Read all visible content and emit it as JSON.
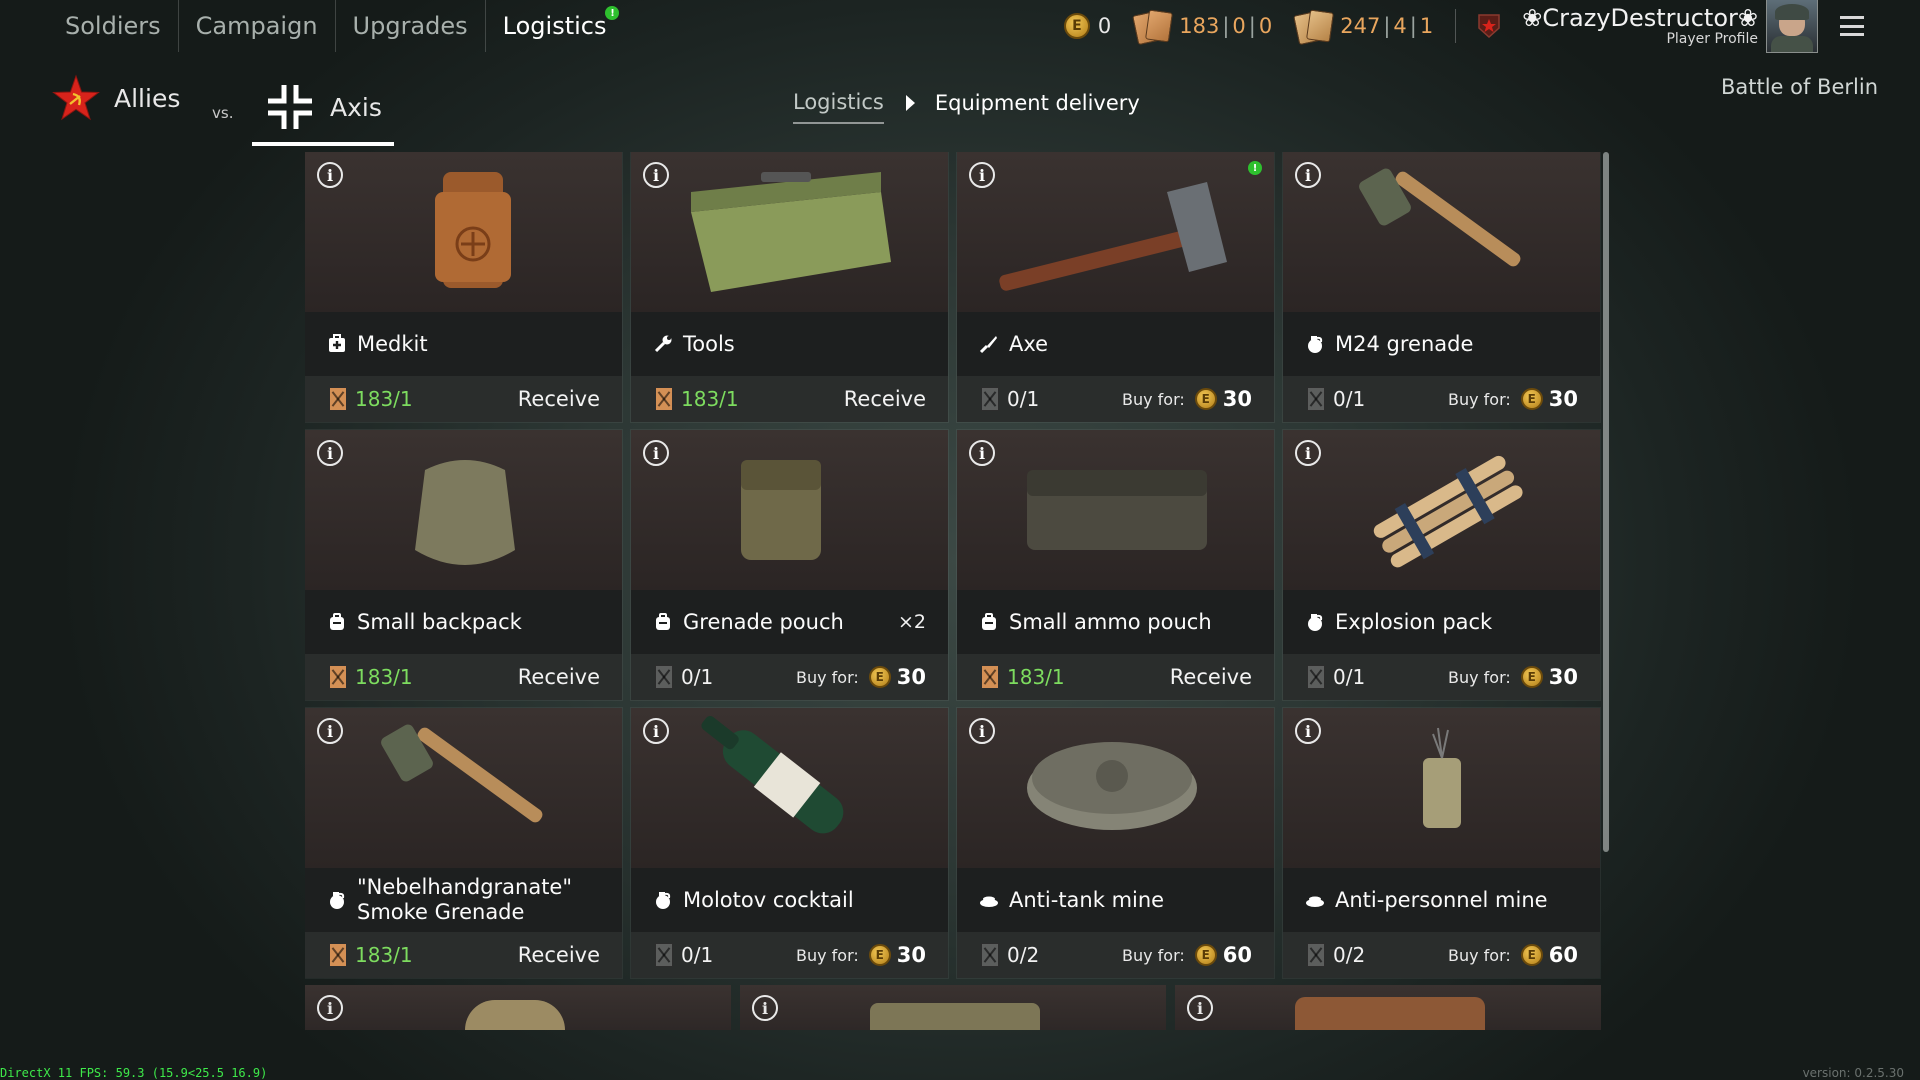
{
  "nav": {
    "tabs": [
      {
        "label": "Soldiers"
      },
      {
        "label": "Campaign"
      },
      {
        "label": "Upgrades"
      },
      {
        "label": "Logistics",
        "badge": "!"
      }
    ],
    "active_tab": "Logistics"
  },
  "currencies": {
    "gold": "0",
    "orders_a": {
      "v1": "183",
      "v2": "0",
      "v3": "0"
    },
    "orders_b": {
      "v1": "247",
      "v2": "4",
      "v3": "1"
    }
  },
  "player": {
    "name": "CrazyDestructor",
    "profile_label": "Player Profile"
  },
  "factions": {
    "allies": "Allies",
    "vs": "vs.",
    "axis": "Axis"
  },
  "breadcrumb": {
    "parent": "Logistics",
    "current": "Equipment delivery"
  },
  "campaign_name": "Battle of Berlin",
  "labels": {
    "receive": "Receive",
    "buy_for": "Buy for:",
    "info": "i",
    "new_badge": "!",
    "coin_letter": "E"
  },
  "items": [
    {
      "name": "Medkit",
      "icon": "medkit-icon",
      "count": "183/1",
      "available": true,
      "action": "receive"
    },
    {
      "name": "Tools",
      "icon": "wrench-icon",
      "count": "183/1",
      "available": true,
      "action": "receive"
    },
    {
      "name": "Axe",
      "icon": "knife-icon",
      "count": "0/1",
      "available": false,
      "action": "buy",
      "price": "30",
      "new": true
    },
    {
      "name": "M24 grenade",
      "icon": "grenade-icon",
      "count": "0/1",
      "available": false,
      "action": "buy",
      "price": "30"
    },
    {
      "name": "Small backpack",
      "icon": "backpack-icon",
      "count": "183/1",
      "available": true,
      "action": "receive"
    },
    {
      "name": "Grenade pouch",
      "icon": "backpack-icon",
      "count": "0/1",
      "available": false,
      "action": "buy",
      "price": "30",
      "multiplier": "×2"
    },
    {
      "name": "Small ammo pouch",
      "icon": "backpack-icon",
      "count": "183/1",
      "available": true,
      "action": "receive"
    },
    {
      "name": "Explosion pack",
      "icon": "grenade-icon",
      "count": "0/1",
      "available": false,
      "action": "buy",
      "price": "30"
    },
    {
      "name": "\"Nebelhandgranate\" Smoke Grenade",
      "icon": "grenade-icon",
      "count": "183/1",
      "available": true,
      "action": "receive"
    },
    {
      "name": "Molotov cocktail",
      "icon": "grenade-icon",
      "count": "0/1",
      "available": false,
      "action": "buy",
      "price": "30"
    },
    {
      "name": "Anti-tank mine",
      "icon": "mine-icon",
      "count": "0/2",
      "available": false,
      "action": "buy",
      "price": "60"
    },
    {
      "name": "Anti-personnel mine",
      "icon": "mine-icon",
      "count": "0/2",
      "available": false,
      "action": "buy",
      "price": "60"
    }
  ],
  "debug": {
    "fps": "DirectX 11 FPS: 59.3 (15.9<25.5 16.9)",
    "version": "version: 0.2.5.30"
  },
  "colors": {
    "accent_green": "#7ddc5f",
    "badge_green": "#2ec02e",
    "ticket_orange": "#d49055",
    "currency_orange": "#e9a65e",
    "soviet_red": "#d8231b"
  }
}
